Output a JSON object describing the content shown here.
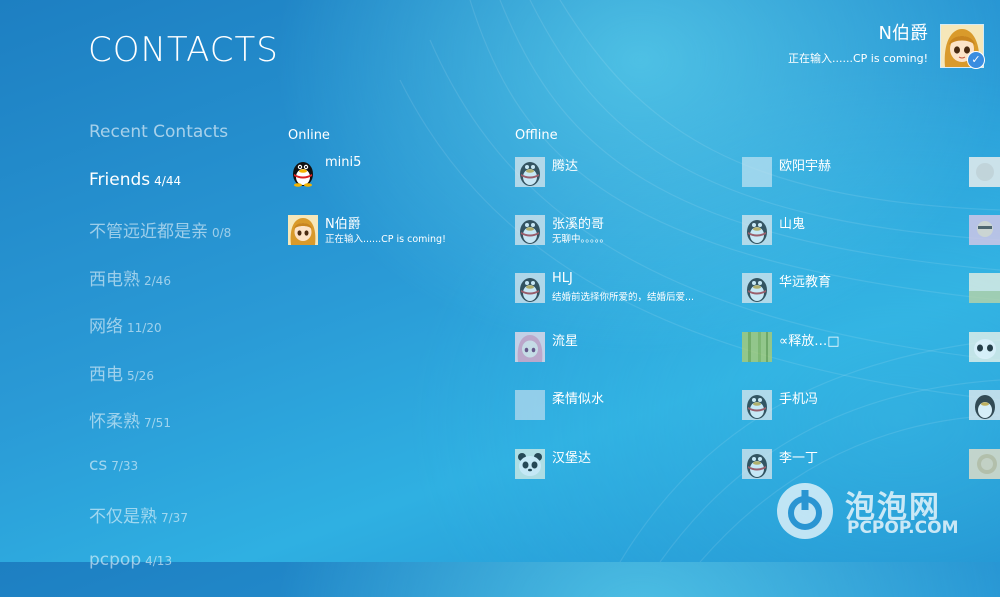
{
  "page": {
    "title": "CONTACTS"
  },
  "user": {
    "name": "N伯爵",
    "status": "正在输入......CP is coming!"
  },
  "groups": [
    {
      "name": "Recent Contacts",
      "count": ""
    },
    {
      "name": "Friends",
      "count": "4/44"
    },
    {
      "name": "不管远近都是亲",
      "count": "0/8"
    },
    {
      "name": "西电熟",
      "count": "2/46"
    },
    {
      "name": "网络",
      "count": "11/20"
    },
    {
      "name": "西电",
      "count": "5/26"
    },
    {
      "name": "怀柔熟",
      "count": "7/51"
    },
    {
      "name": "cs",
      "count": "7/33"
    },
    {
      "name": "不仅是熟",
      "count": "7/37"
    },
    {
      "name": "pcpop",
      "count": "4/13"
    }
  ],
  "online": {
    "label": "Online",
    "contacts": [
      {
        "name": "mini5",
        "status": "",
        "avatar": "penguin-icon"
      },
      {
        "name": "N伯爵",
        "status": "正在输入......CP is coming!",
        "avatar": "anime-girl-avatar"
      }
    ]
  },
  "offline": {
    "label": "Offline",
    "contacts": [
      {
        "name": "腾达",
        "status": "",
        "avatar": "penguin-icon"
      },
      {
        "name": "张溪的哥",
        "status": "无聊中。。。。。",
        "avatar": "penguin-icon"
      },
      {
        "name": "HLJ",
        "status": "结婚前选择你所爱的，结婚后爱...",
        "avatar": "penguin-icon"
      },
      {
        "name": "流星",
        "status": "",
        "avatar": "pink-anime-avatar"
      },
      {
        "name": "柔情似水",
        "status": "",
        "avatar": "blank-avatar"
      },
      {
        "name": "汉堡达",
        "status": "",
        "avatar": "panda-icon"
      },
      {
        "name": "欧阳宇赫",
        "status": "",
        "avatar": "blank-avatar"
      },
      {
        "name": "山鬼",
        "status": "",
        "avatar": "penguin-icon"
      },
      {
        "name": "华远教育",
        "status": "",
        "avatar": "penguin-icon"
      },
      {
        "name": "∝释放…□",
        "status": "",
        "avatar": "bamboo-avatar"
      },
      {
        "name": "手机冯",
        "status": "",
        "avatar": "penguin-icon"
      },
      {
        "name": "李一丁",
        "status": "",
        "avatar": "penguin-icon"
      }
    ]
  },
  "watermark": {
    "cn": "泡泡网",
    "en": "PCPOP.COM"
  },
  "colors": {
    "bg_dark": "#1d7fc2",
    "bg_light": "#4fd2ea",
    "text": "#ffffff"
  }
}
